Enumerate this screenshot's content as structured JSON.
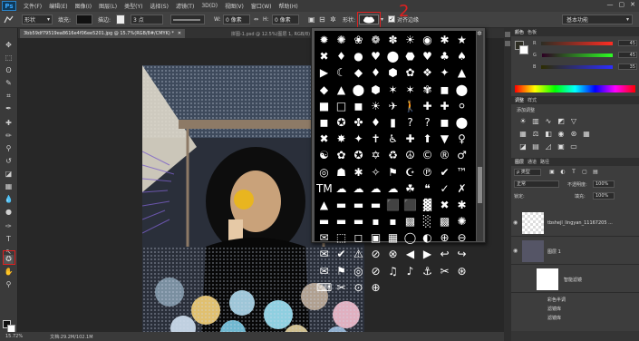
{
  "menubar": {
    "logo": "Ps",
    "items": [
      "文件(F)",
      "编辑(E)",
      "图像(I)",
      "图层(L)",
      "类型(Y)",
      "选择(S)",
      "滤镜(T)",
      "3D(D)",
      "视图(V)",
      "窗口(W)",
      "帮助(H)"
    ],
    "window_controls": [
      "—",
      "▢",
      "✕"
    ]
  },
  "options": {
    "mode": "形状",
    "fill_label": "填充:",
    "stroke_label": "描边:",
    "stroke_size": "3 点",
    "w_label": "W:",
    "w_value": "0 像素",
    "h_label": "H:",
    "h_value": "0 像素",
    "shape_label": "形状:",
    "align_edges_label": "对齐边缘",
    "annotation": "2",
    "workspace": "基本功能"
  },
  "document": {
    "tab_title": "3bb59df79519ea8616e4f06ee5201.jpg @ 15.7%(RGB/8#/CMYK) *",
    "tab2_title": "拼图-1.psd @ 12.5%(图层 1, RGB/8)"
  },
  "status": {
    "zoom": "15.72%",
    "doc_size": "文档:29.2M/102.1M"
  },
  "shapes": [
    "✹",
    "✺",
    "❀",
    "❁",
    "✽",
    "☀",
    "◉",
    "✱",
    "★",
    "✖",
    "♦",
    "●",
    "♥",
    "⬤",
    "⬣",
    "♥",
    "♣",
    "♠",
    "▶",
    "☾",
    "◆",
    "♦",
    "⬢",
    "✿",
    "❖",
    "✦",
    "▲",
    "◆",
    "▲",
    "⬤",
    "⬢",
    "✶",
    "✶",
    "✾",
    "◼",
    "⬤",
    "■",
    "□",
    "◼",
    "☀",
    "✈",
    "🚶",
    "✚",
    "✚",
    "⚪",
    "◼",
    "✪",
    "✤",
    "♦",
    "▮",
    "?",
    "?",
    "◼",
    "⬤",
    "✖",
    "✸",
    "✦",
    "✝",
    "♿",
    "✚",
    "⬆",
    "▼",
    "♀",
    "☯",
    "✿",
    "✪",
    "✡",
    "♻",
    "☮",
    "©",
    "®",
    "♂",
    "◎",
    "☗",
    "✱",
    "✧",
    "⚑",
    "☪",
    "℗",
    "✔",
    "™",
    "TM",
    "☁",
    "☁",
    "☁",
    "☁",
    "☘",
    "❝",
    "✓",
    "✗",
    "▲",
    "▬",
    "▬",
    "▬",
    "⬛",
    "⬛",
    "▓",
    "✖",
    "✱",
    "▬",
    "▬",
    "▬",
    "▪",
    "▪",
    "▩",
    "░",
    "▩",
    "✺",
    "✉",
    "⬚",
    "◻",
    "▣",
    "▦",
    "◯",
    "◐",
    "⊕",
    "⊖",
    "✉",
    "✔",
    "⚠",
    "⊘",
    "⊗",
    "◀",
    "▶",
    "↩",
    "↪",
    "✉",
    "⚑",
    "◎",
    "⊘",
    "♫",
    "♪",
    "⚓",
    "✂",
    "⊛",
    "⌨",
    "✂",
    "⊙",
    "⊕",
    "",
    "",
    "",
    "",
    ""
  ],
  "panels": {
    "color_tabs": [
      "颜色",
      "色板"
    ],
    "r_label": "R",
    "g_label": "G",
    "b_label": "B",
    "r_value": "45",
    "g_value": "45",
    "b_value": "35",
    "adjust_tabs": [
      "调整",
      "样式"
    ],
    "adjust_title": "添加调整",
    "layers_tabs": [
      "图层",
      "通道",
      "路径"
    ],
    "kind_label": "ρ 类型",
    "blend_mode": "正常",
    "opacity_label": "不透明度:",
    "opacity_value": "100%",
    "lock_label": "锁定:",
    "fill_label": "填充:",
    "fill_value": "100%",
    "layers": [
      {
        "name": "tbshejl_lingyan_11167205 ..."
      },
      {
        "name": "图层 1"
      },
      {
        "name": "智能滤镜"
      }
    ],
    "sub_filters": [
      "彩色半调",
      "滤镜库",
      "滤镜库"
    ]
  },
  "colors": {
    "annotation_red": "#e02020",
    "fg_color": "#111111",
    "bg_color": "#ffffff"
  }
}
